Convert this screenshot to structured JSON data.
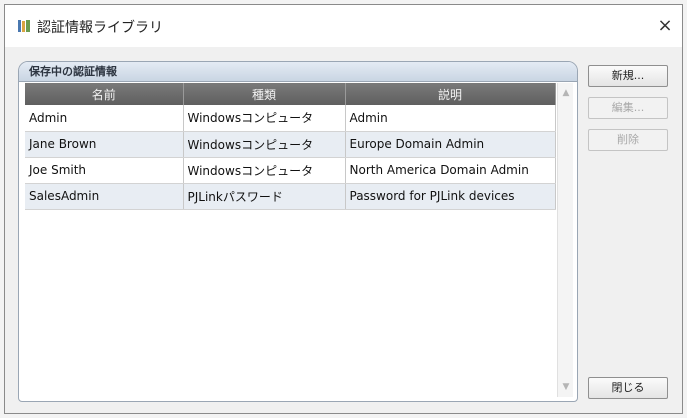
{
  "window": {
    "title": "認証情報ライブラリ",
    "close_glyph": "×"
  },
  "group": {
    "title": "保存中の認証情報"
  },
  "table": {
    "columns": [
      "名前",
      "種類",
      "説明"
    ],
    "rows": [
      {
        "name": "Admin",
        "type": "Windowsコンピュータ",
        "description": "Admin"
      },
      {
        "name": "Jane Brown",
        "type": "Windowsコンピュータ",
        "description": "Europe Domain Admin"
      },
      {
        "name": "Joe Smith",
        "type": "Windowsコンピュータ",
        "description": "North America Domain Admin"
      },
      {
        "name": "SalesAdmin",
        "type": "PJLinkパスワード",
        "description": "Password for PJLink devices"
      }
    ]
  },
  "buttons": {
    "new_label": "新規...",
    "edit_label": "編集...",
    "delete_label": "削除",
    "close_label": "閉じる"
  },
  "icons": {
    "app": "library-icon",
    "scroll_up": "▲",
    "scroll_down": "▼"
  }
}
